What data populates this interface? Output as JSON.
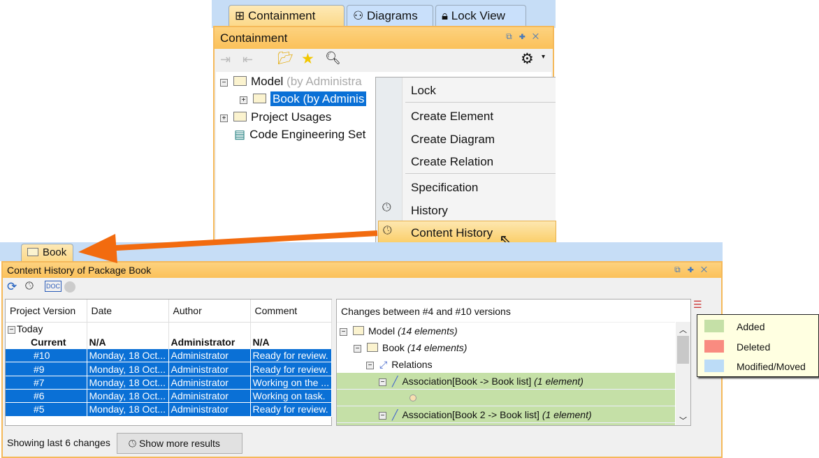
{
  "top_tabs": [
    {
      "label": "Containment",
      "active": true
    },
    {
      "label": "Diagrams"
    },
    {
      "label": "Lock View"
    }
  ],
  "containment": {
    "title": "Containment",
    "tree": [
      {
        "label": "Model",
        "suffix": " (by Administra"
      },
      {
        "label": "Book (by Adminis"
      },
      {
        "label": "Project Usages"
      },
      {
        "label": "Code Engineering Set"
      }
    ]
  },
  "context_menu": {
    "items": [
      "Lock",
      "Create Element",
      "Create Diagram",
      "Create Relation",
      "Specification",
      "History",
      "Content History"
    ]
  },
  "bottom_tab": {
    "label": "Book"
  },
  "content_history": {
    "title": "Content History of Package Book",
    "columns": [
      "Project Version",
      "Date",
      "Author",
      "Comment"
    ],
    "group": "Today",
    "rows": [
      {
        "version": "Current",
        "date": "N/A",
        "author": "Administrator",
        "comment": "N/A"
      },
      {
        "version": "#10",
        "date": "Monday, 18 Oct...",
        "author": "Administrator",
        "comment": "Ready for review."
      },
      {
        "version": "#9",
        "date": "Monday, 18 Oct...",
        "author": "Administrator",
        "comment": "Ready for review."
      },
      {
        "version": "#7",
        "date": "Monday, 18 Oct...",
        "author": "Administrator",
        "comment": "Working on the ..."
      },
      {
        "version": "#6",
        "date": "Monday, 18 Oct...",
        "author": "Administrator",
        "comment": "Working on task."
      },
      {
        "version": "#5",
        "date": "Monday, 18 Oct...",
        "author": "Administrator",
        "comment": "Ready for review."
      }
    ],
    "changes_header": "Changes between #4 and #10 versions",
    "changes": [
      {
        "label": "Model",
        "note": "(14 elements)"
      },
      {
        "label": "Book",
        "note": "(14 elements)"
      },
      {
        "label": "Relations",
        "note": ""
      },
      {
        "label": "Association[Book -> Book list]",
        "note": "(1 element)"
      },
      {
        "label": "",
        "note": ""
      },
      {
        "label": "Association[Book 2 -> Book list]",
        "note": "(1 element)"
      }
    ],
    "status": "Showing last 6 changes",
    "show_more": "Show more results"
  },
  "legend": {
    "items": [
      {
        "label": "Added",
        "color": "#c5e0a7"
      },
      {
        "label": "Deleted",
        "color": "#f98b80"
      },
      {
        "label": "Modified/Moved",
        "color": "#bcdcf7"
      }
    ]
  }
}
